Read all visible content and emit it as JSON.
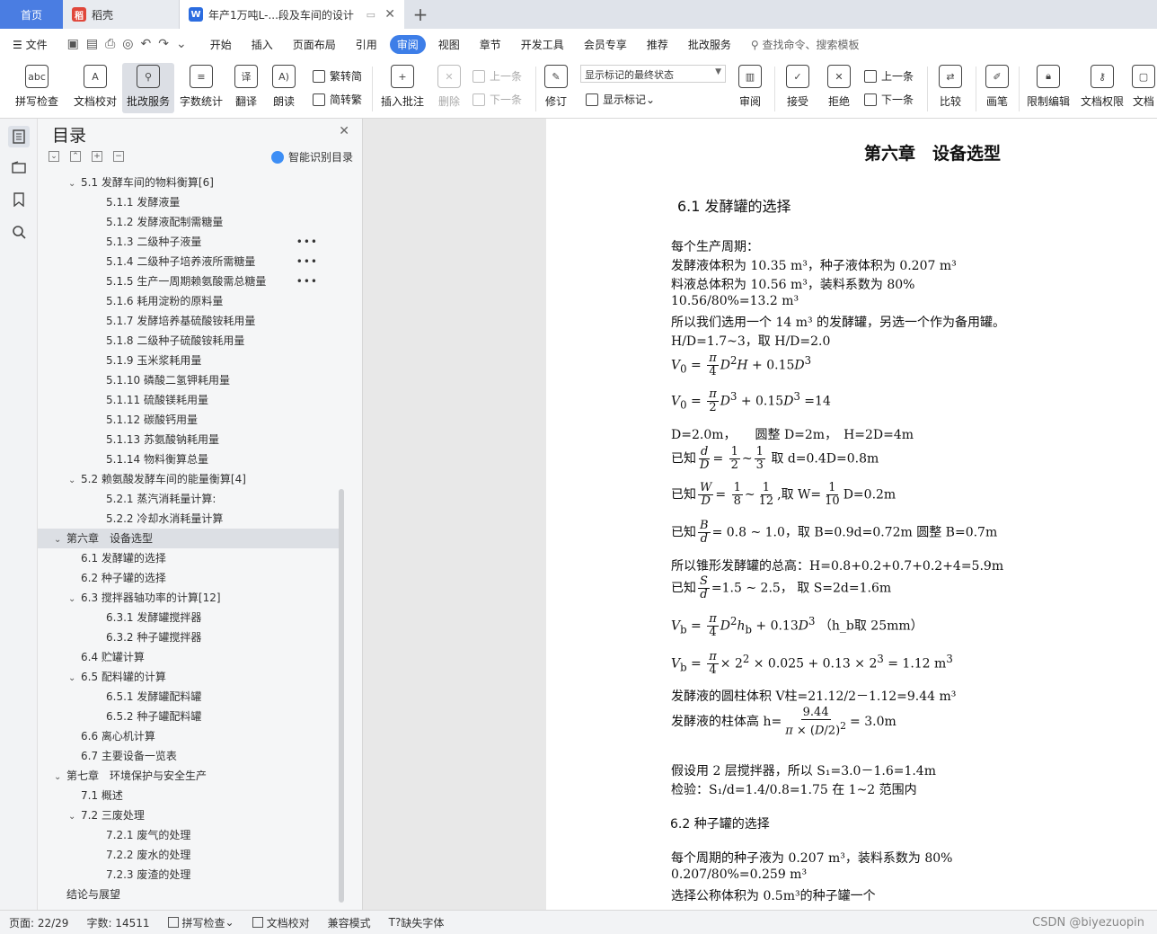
{
  "tabs": {
    "home": "首页",
    "daoke": "稻壳",
    "doc": "年产1万吨L-...段及车间的设计"
  },
  "menu": [
    "文件",
    "开始",
    "插入",
    "页面布局",
    "引用",
    "审阅",
    "视图",
    "章节",
    "开发工具",
    "会员专享",
    "推荐",
    "批改服务"
  ],
  "menu_active": "审阅",
  "search_placeholder": "查找命令、搜索模板",
  "ribbon": {
    "spell": "拼写检查",
    "proof": "文档校对",
    "review_service": "批改服务",
    "word_count": "字数统计",
    "translate": "翻译",
    "read": "朗读",
    "to_trad": "繁转简",
    "to_simp": "简转繁",
    "insert_comment": "插入批注",
    "delete": "删除",
    "prev1": "上一条",
    "next1": "下一条",
    "revise": "修订",
    "markup_state": "显示标记的最终状态",
    "show_markup": "显示标记",
    "review": "审阅",
    "accept": "接受",
    "reject": "拒绝",
    "prev2": "上一条",
    "next2": "下一条",
    "compare": "比较",
    "pen": "画笔",
    "restrict": "限制编辑",
    "doc_perm": "文档权限",
    "doc_more": "文档"
  },
  "toc": {
    "title": "目录",
    "smart": "智能识别目录",
    "items": [
      {
        "text": "5.1 发酵车间的物料衡算[6]",
        "level": 1,
        "chev": true
      },
      {
        "text": "5.1.1 发酵液量",
        "level": 2
      },
      {
        "text": "5.1.2 发酵液配制需糖量",
        "level": 2
      },
      {
        "text": "5.1.3 二级种子液量",
        "level": 2,
        "more": true
      },
      {
        "text": "5.1.4 二级种子培养液所需糖量",
        "level": 2,
        "more": true
      },
      {
        "text": "5.1.5 生产一周期赖氨酸需总糖量",
        "level": 2,
        "more": true
      },
      {
        "text": "5.1.6 耗用淀粉的原料量",
        "level": 2
      },
      {
        "text": "5.1.7 发酵培养基硫酸铵耗用量",
        "level": 2
      },
      {
        "text": "5.1.8 二级种子硫酸铵耗用量",
        "level": 2
      },
      {
        "text": "5.1.9 玉米浆耗用量",
        "level": 2
      },
      {
        "text": "5.1.10 磷酸二氢钾耗用量",
        "level": 2
      },
      {
        "text": "5.1.11 硫酸镁耗用量",
        "level": 2
      },
      {
        "text": "5.1.12 碳酸钙用量",
        "level": 2
      },
      {
        "text": "5.1.13 苏氨酸钠耗用量",
        "level": 2
      },
      {
        "text": "5.1.14 物料衡算总量",
        "level": 2
      },
      {
        "text": "5.2 赖氨酸发酵车间的能量衡算[4]",
        "level": 1,
        "chev": true
      },
      {
        "text": "5.2.1 蒸汽消耗量计算:",
        "level": 2
      },
      {
        "text": "5.2.2 冷却水消耗量计算",
        "level": 2
      },
      {
        "text": "第六章　设备选型",
        "level": 0,
        "chev": true,
        "sel": true
      },
      {
        "text": "6.1 发酵罐的选择",
        "level": 1
      },
      {
        "text": "6.2 种子罐的选择",
        "level": 1
      },
      {
        "text": "6.3 搅拌器轴功率的计算[12]",
        "level": 1,
        "chev": true
      },
      {
        "text": "6.3.1 发酵罐搅拌器",
        "level": 2
      },
      {
        "text": "6.3.2 种子罐搅拌器",
        "level": 2
      },
      {
        "text": "6.4 贮罐计算",
        "level": 1
      },
      {
        "text": "6.5 配料罐的计算",
        "level": 1,
        "chev": true
      },
      {
        "text": "6.5.1 发酵罐配料罐",
        "level": 2
      },
      {
        "text": "6.5.2 种子罐配料罐",
        "level": 2
      },
      {
        "text": "6.6 离心机计算",
        "level": 1
      },
      {
        "text": "6.7 主要设备一览表",
        "level": 1
      },
      {
        "text": "第七章　环境保护与安全生产",
        "level": 0,
        "chev": true
      },
      {
        "text": "7.1 概述",
        "level": 1
      },
      {
        "text": "7.2 三废处理",
        "level": 1,
        "chev": true
      },
      {
        "text": "7.2.1 废气的处理",
        "level": 2
      },
      {
        "text": "7.2.2 废水的处理",
        "level": 2
      },
      {
        "text": "7.2.3 废渣的处理",
        "level": 2
      },
      {
        "text": "结论与展望",
        "level": 0
      }
    ]
  },
  "doc": {
    "chapter": "第六章　设备选型",
    "h61": "6.1  发酵罐的选择",
    "l1": "每个生产周期：",
    "l2": "发酵液体积为 10.35 m³，种子液体积为 0.207 m³",
    "l3": "料液总体积为 10.56 m³，装料系数为 80%",
    "l4": "10.56/80%=13.2 m³",
    "l5": "所以我们选用一个 14 m³ 的发酵罐，另选一个作为备用罐。",
    "l6": "H/D=1.7~3，取 H/D=2.0",
    "l10": "D=2.0m，　　圆整 D=2m，　H=2D=4m",
    "l11b": "取 d=0.4D=0.8m",
    "l12b": ",取 W=",
    "l12c": "D=0.2m",
    "l13b": "= 0.8 ~ 1.0，取 B=0.9d=0.72m  圆整 B=0.7m",
    "l14": "所以锥形发酵罐的总高：H=0.8+0.2+0.7+0.2+4=5.9m",
    "l15b": "=1.5 ~ 2.5，  取 S=2d=1.6m",
    "l16b": "（h_b取 25mm）",
    "l18": "发酵液的圆柱体积 V柱=21.12/2－1.12=9.44 m³",
    "l19": "发酵液的柱体高 h=",
    "l19b": "= 3.0m",
    "l20": "假设用 2 层搅拌器，所以 S₁=3.0－1.6=1.4m",
    "l21": "检验：S₁/d=1.4/0.8=1.75 在 1~2 范围内",
    "h62": "6.2  种子罐的选择",
    "l22": "每个周期的种子液为 0.207 m³，装料系数为 80%",
    "l23": "0.207/80%=0.259 m³",
    "l24": "选择公称体积为 0.5m³的种子罐一个",
    "known": "已知"
  },
  "status": {
    "page": "页面: 22/29",
    "words": "字数: 14511",
    "spell": "拼写检查",
    "proof": "文档校对",
    "compat": "兼容模式",
    "missing_font": "缺失字体",
    "watermark": "CSDN @biyezuopin"
  }
}
